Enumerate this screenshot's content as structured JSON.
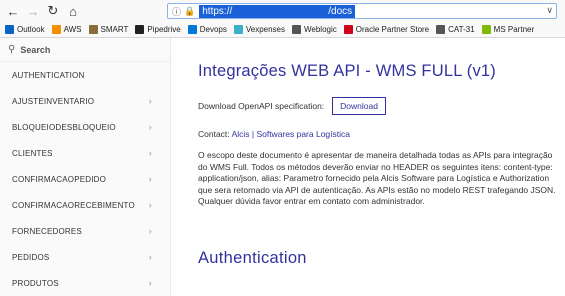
{
  "browser": {
    "url_protocol": "https://",
    "url_path": "/docs",
    "bookmarks": [
      {
        "label": "Outlook",
        "icon": "outlook-icon",
        "color": "#0a64c8"
      },
      {
        "label": "AWS",
        "icon": "aws-icon",
        "color": "#f29100"
      },
      {
        "label": "SMART",
        "icon": "smart-icon",
        "color": "#8a6d3b"
      },
      {
        "label": "Pipedrive",
        "icon": "pipedrive-icon",
        "color": "#222222"
      },
      {
        "label": "Devops",
        "icon": "devops-icon",
        "color": "#0078d7"
      },
      {
        "label": "Vexpenses",
        "icon": "vexpenses-icon",
        "color": "#3bb0c9"
      },
      {
        "label": "Weblogic",
        "icon": "globe-icon",
        "color": "#555555"
      },
      {
        "label": "Oracle Partner Store",
        "icon": "oracle-icon",
        "color": "#d0011b"
      },
      {
        "label": "CAT-31",
        "icon": "cat-icon",
        "color": "#555555"
      },
      {
        "label": "MS Partner",
        "icon": "microsoft-icon",
        "color": "#7fba00"
      }
    ]
  },
  "sidebar": {
    "search_label": "Search",
    "items": [
      {
        "label": "AUTHENTICATION",
        "has_children": false
      },
      {
        "label": "AJUSTEINVENTARIO",
        "has_children": true
      },
      {
        "label": "BLOQUEIODESBLOQUEIO",
        "has_children": true
      },
      {
        "label": "CLIENTES",
        "has_children": true
      },
      {
        "label": "CONFIRMACAOPEDIDO",
        "has_children": true
      },
      {
        "label": "CONFIRMACAORECEBIMENTO",
        "has_children": true
      },
      {
        "label": "FORNECEDORES",
        "has_children": true
      },
      {
        "label": "PEDIDOS",
        "has_children": true
      },
      {
        "label": "PRODUTOS",
        "has_children": true
      }
    ]
  },
  "main": {
    "title": "Integrações WEB API - WMS FULL (v1)",
    "download_text": "Download OpenAPI specification:",
    "download_button": "Download",
    "contact_label": "Contact:",
    "contact_link": "Alcis | Softwares para Logística",
    "description": "O escopo deste documento é apresentar de maneira detalhada todas as APIs para integração do WMS Full. Todos os métodos deverão enviar no HEADER os seguintes itens: content-type: application/json, alias: Parametro fornecido pela Alcis Software para Logística e Authorization que sera retornado via API de autenticação. As APIs estão no modelo REST trafegando JSON. Qualquer dúvida favor entrar em contato com administrador.",
    "section_title": "Authentication"
  },
  "colors": {
    "accent": "#32329f",
    "url_highlight": "#1a61d8"
  }
}
